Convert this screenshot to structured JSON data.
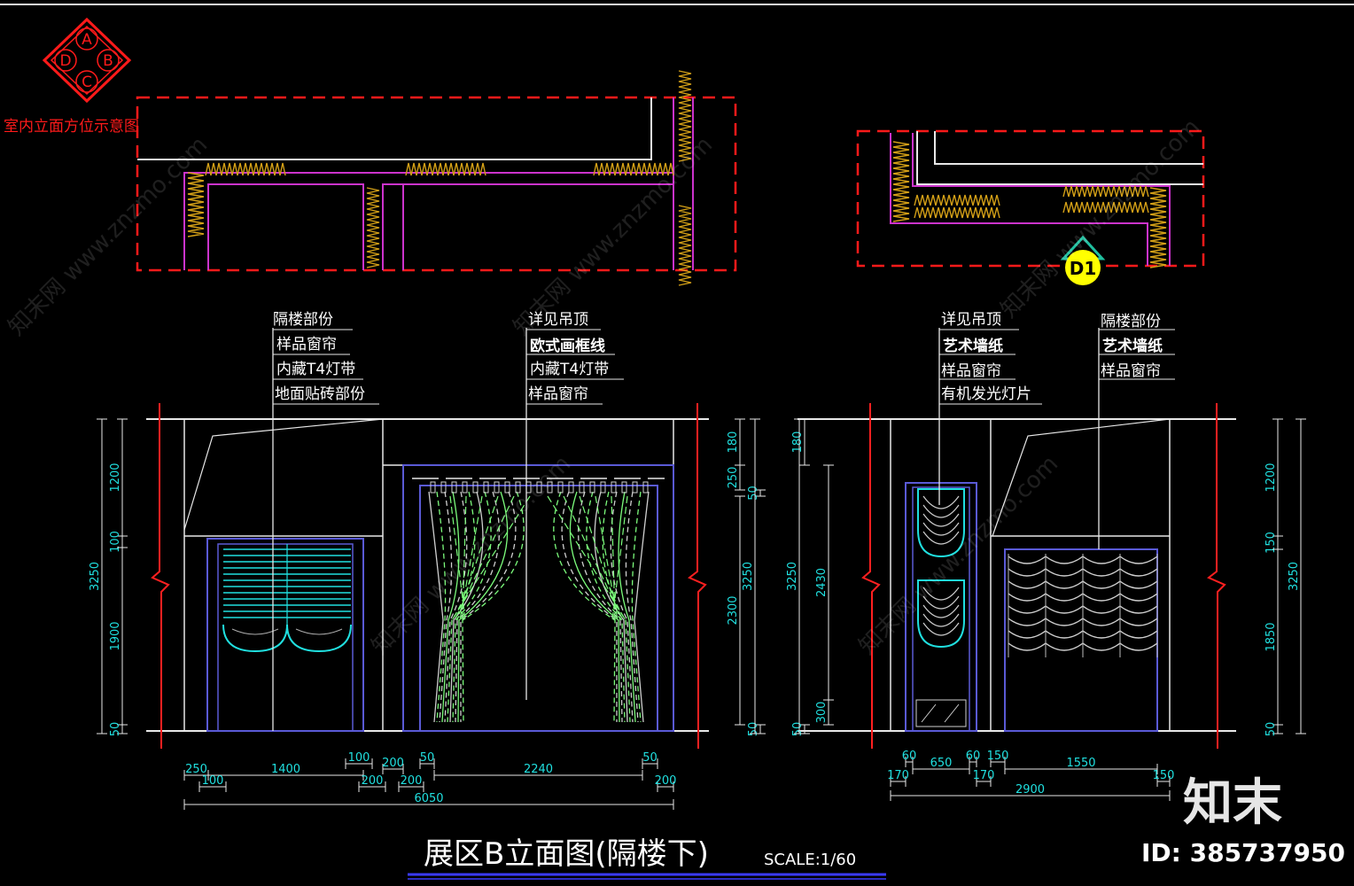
{
  "orientation_legend": {
    "letters": [
      "A",
      "B",
      "C",
      "D"
    ],
    "label": "室内立面方位示意图"
  },
  "section_marker": "D1",
  "left_elevation": {
    "callouts_group1": [
      "隔楼部份",
      "样品窗帘",
      "内藏T4灯带",
      "地面贴砖部份"
    ],
    "callouts_group2": [
      "详见吊顶",
      "欧式画框线",
      "内藏T4灯带",
      "样品窗帘"
    ],
    "dims_left": [
      "1200",
      "100",
      "1900",
      "50"
    ],
    "dims_total_left": "3250",
    "dims_right": [
      "180",
      "250",
      "50",
      "2300",
      "50"
    ],
    "dims_total_right": "3250",
    "dims_bottom_row1": [
      "250",
      "1400",
      "100",
      "200",
      "50",
      "2240",
      "50"
    ],
    "dims_bottom_row2": [
      "100",
      "200",
      "200",
      "200"
    ],
    "dims_overall": "6050"
  },
  "right_elevation": {
    "callouts_group1": [
      "详见吊顶",
      "艺术墙纸",
      "样品窗帘",
      "有机发光灯片"
    ],
    "callouts_group2": [
      "隔楼部份",
      "艺术墙纸",
      "样品窗帘"
    ],
    "dims_left": [
      "180",
      "2430",
      "300",
      "50"
    ],
    "dims_total_left": "3250",
    "dims_right": [
      "1200",
      "150",
      "1850",
      "50"
    ],
    "dims_total_right": "3250",
    "dims_bottom_row1": [
      "60",
      "650",
      "60",
      "150",
      "1550"
    ],
    "dims_bottom_row2": [
      "170",
      "170",
      "150"
    ],
    "dims_overall": "2900"
  },
  "title": "展区B立面图(隔楼下)",
  "scale": "SCALE:1/60",
  "watermark": {
    "logo": "知末",
    "id_text": "ID: 385737950",
    "site_text": "知末网 www.znzmo.com"
  },
  "colors": {
    "background": "#000000",
    "plan_border": "#ff1a1a",
    "wall": "#cc33cc",
    "insulation": "#d4a017",
    "elevation_line": "#e8e8e8",
    "frame": "#5a5ad6",
    "curtain_cyan": "#20e0e0",
    "curtain_green": "#7cfc7c",
    "dim_text": "#20e0e0",
    "break_line": "#ff2020",
    "title_underline": "#3a3aff"
  }
}
